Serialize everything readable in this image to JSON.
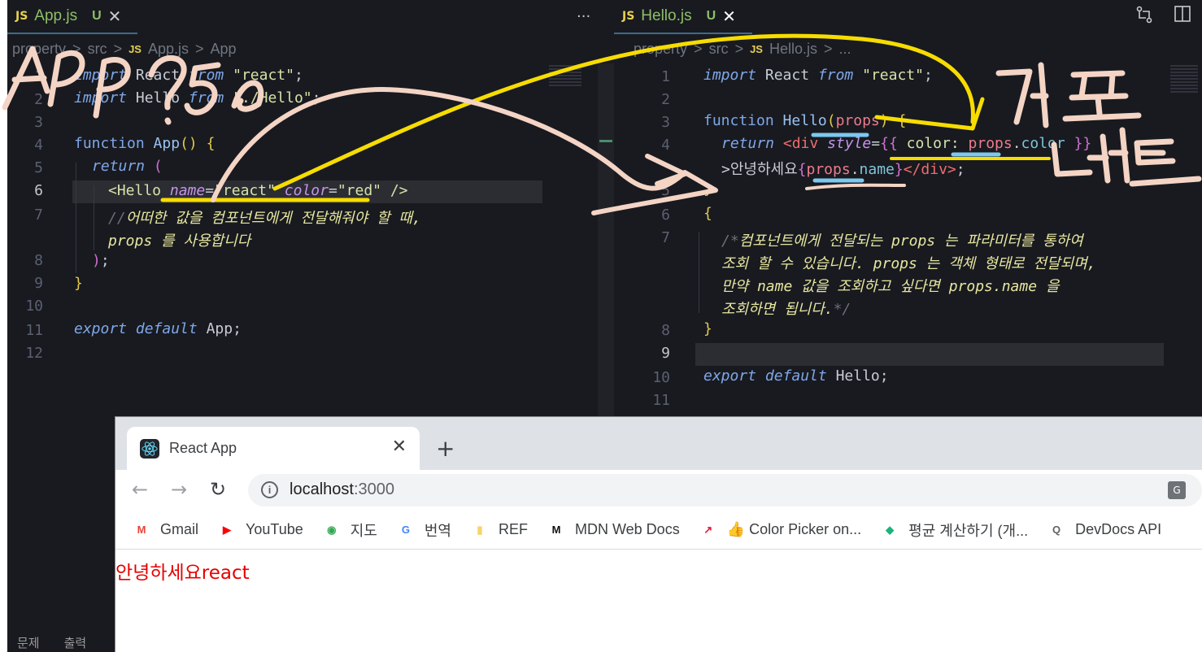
{
  "left_editor": {
    "tab": {
      "badge": "JS",
      "name": "App.js",
      "status": "U",
      "close": "✕"
    },
    "more": "···",
    "breadcrumb": [
      "property",
      ">",
      "src",
      ">",
      "JS",
      "App.js",
      ">",
      "App"
    ],
    "line_numbers": [
      "1",
      "2",
      "3",
      "4",
      "5",
      "6",
      "7",
      "",
      "8",
      "9",
      "10",
      "11",
      "12"
    ],
    "lines": {
      "l1_import": "import",
      "l1_name": "React",
      "l1_from": "from",
      "l1_str": "\"react\"",
      "l1_semi": ";",
      "l2_import": "import",
      "l2_name": "Hello",
      "l2_from": "from",
      "l2_str": "\"./Hello\"",
      "l2_semi": ";",
      "l4_function": "function",
      "l4_name": "App",
      "l4_paren": "()",
      "l4_brace": "{",
      "l5_return": "return",
      "l5_paren": "(",
      "l6_tag": "<Hello",
      "l6_attr1": "name",
      "l6_eq1": "=",
      "l6_val1": "\"react\"",
      "l6_attr2": "color",
      "l6_eq2": "=",
      "l6_val2": "\"red\"",
      "l6_close": "/>",
      "l7_slashes": "//",
      "l7_comment": "어떠한 값을 컴포넌트에게 전달해줘야 할 때,",
      "l7b_comment": "props 를 사용합니다",
      "l8_paren": ")",
      "l8_semi": ";",
      "l9_brace": "}",
      "l11_export": "export",
      "l11_default": "default",
      "l11_name": "App",
      "l11_semi": ";"
    }
  },
  "right_editor": {
    "tab": {
      "badge": "JS",
      "name": "Hello.js",
      "status": "U",
      "close": "✕"
    },
    "breadcrumb": [
      "property",
      ">",
      "src",
      ">",
      "JS",
      "Hello.js",
      ">",
      "..."
    ],
    "line_numbers": [
      "1",
      "2",
      "3",
      "4",
      "",
      "5",
      "6",
      "7",
      "",
      "",
      "",
      "8",
      "9",
      "10",
      "11"
    ],
    "lines": {
      "l1_import": "import",
      "l1_name": "React",
      "l1_from": "from",
      "l1_str": "\"react\"",
      "l1_semi": ";",
      "l3_function": "function",
      "l3_name": "Hello",
      "l3_paren_open": "(",
      "l3_param": "props",
      "l3_paren_close": ")",
      "l3_brace": "{",
      "l4_return": "return",
      "l4_tag": "<div",
      "l4_attr": "style",
      "l4_eq": "=",
      "l4_open": "{{",
      "l4_key": "color:",
      "l4_obj": "props",
      "l4_dot": ".",
      "l4_prop": "color",
      "l4_close": "}}",
      "l4b_gt": ">",
      "l4b_text": "안녕하세요",
      "l4b_open": "{",
      "l4b_obj": "props",
      "l4b_dot": ".",
      "l4b_prop": "name",
      "l4b_close": "}",
      "l4b_end": "</div>",
      "l4b_semi": ";",
      "l5_brace": "}",
      "l6_brace": "{",
      "l7_open": "/*",
      "l7_text": "컴포넌트에게 전달되는 props 는 파라미터를 통하여",
      "l7b_text": "조회 할 수 있습니다. props 는 객체 형태로 전달되며,",
      "l7c_text": "만약 name 값을 조회하고 싶다면 props.name 을",
      "l7d_text": "조회하면 됩니다.",
      "l7d_close": "*/",
      "l8_brace": "}",
      "l10_export": "export",
      "l10_default": "default",
      "l10_name": "Hello",
      "l10_semi": ";"
    }
  },
  "panel_tabs": [
    "문제",
    "출력"
  ],
  "browser": {
    "tab_title": "React App",
    "tab_close": "✕",
    "new_tab": "+",
    "back": "←",
    "forward": "→",
    "reload": "↻",
    "info": "i",
    "url_host": "localhost",
    "url_port": ":3000",
    "bookmarks": [
      {
        "label": "Gmail",
        "icon": "gmail-icon",
        "glyph": "M",
        "color": "#ea4335"
      },
      {
        "label": "YouTube",
        "icon": "youtube-icon",
        "glyph": "▶",
        "color": "#ff0000"
      },
      {
        "label": "지도",
        "icon": "maps-icon",
        "glyph": "◉",
        "color": "#34a853"
      },
      {
        "label": "번역",
        "icon": "translate-icon",
        "glyph": "G",
        "color": "#4285f4"
      },
      {
        "label": "REF",
        "icon": "folder-icon",
        "glyph": "▮",
        "color": "#f6d46a"
      },
      {
        "label": "MDN Web Docs",
        "icon": "mdn-icon",
        "glyph": "M",
        "color": "#111111"
      },
      {
        "label": "👍 Color Picker on...",
        "icon": "color-picker-icon",
        "glyph": "↗",
        "color": "#e8173b"
      },
      {
        "label": "평균 계산하기 (개...",
        "icon": "calculator-icon",
        "glyph": "◆",
        "color": "#1bb37b"
      },
      {
        "label": "DevDocs API",
        "icon": "devdocs-icon",
        "glyph": "Q",
        "color": "#5f6368"
      }
    ],
    "page_text": "안녕하세요react"
  },
  "annotations": {
    "left_scribble": "App?5b",
    "right_scribble_1": "컴포",
    "right_scribble_2": "넌트"
  },
  "colors": {
    "editor_bg": "#181a20",
    "highlight_yellow": "#f7dc00",
    "highlight_blue": "#7cc8ef",
    "ink_peach": "#f4d4c4",
    "page_red": "#e60000"
  }
}
